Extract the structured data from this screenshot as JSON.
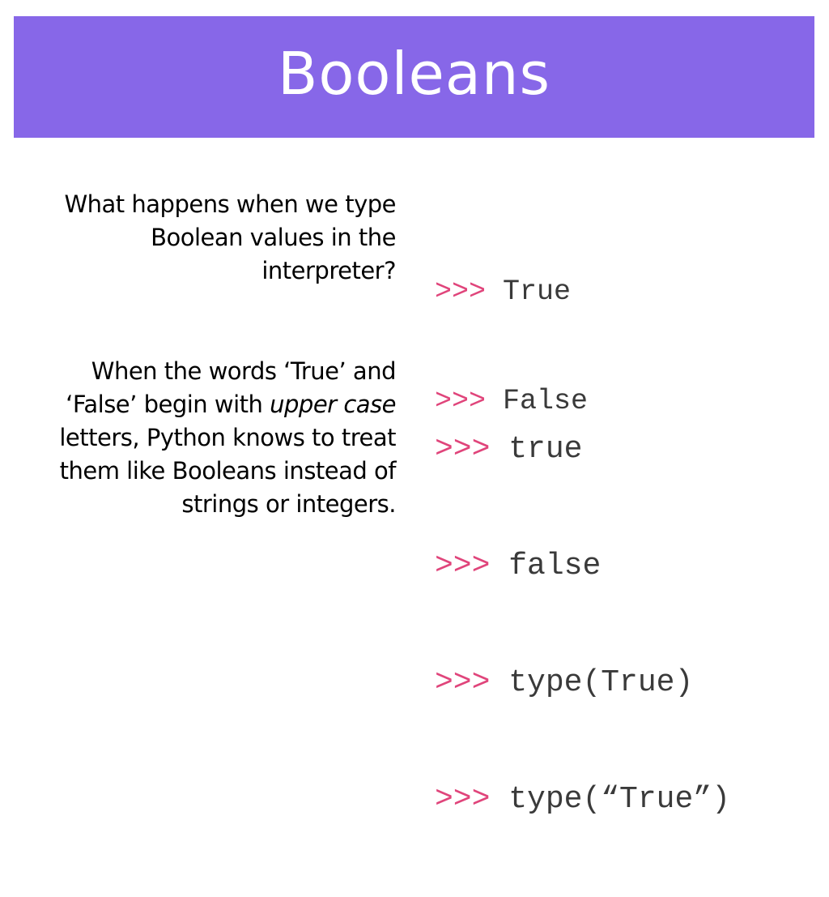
{
  "slide": {
    "title": "Booleans",
    "colors": {
      "title_bar": "#8767e8",
      "title_text": "#ffffff",
      "prompt": "#e0457b",
      "code": "#3a3a3a"
    },
    "blocks": [
      {
        "question": "What happens when we type Boolean values in the interpreter?",
        "code": [
          {
            "prompt": ">>>",
            "text": " True"
          },
          {
            "prompt": ">>>",
            "text": " False"
          }
        ]
      },
      {
        "question_parts": {
          "before": "When the words ‘True’ and ‘False’ begin with ",
          "emphasis": "upper case",
          "after": " letters, Python knows to treat them like Booleans instead of strings or integers."
        },
        "code": [
          {
            "prompt": ">>>",
            "text": " true"
          },
          {
            "prompt": ">>>",
            "text": " false"
          },
          {
            "prompt": ">>>",
            "text": " type(True)"
          },
          {
            "prompt": ">>>",
            "text": " type(“True”)"
          }
        ]
      }
    ]
  }
}
